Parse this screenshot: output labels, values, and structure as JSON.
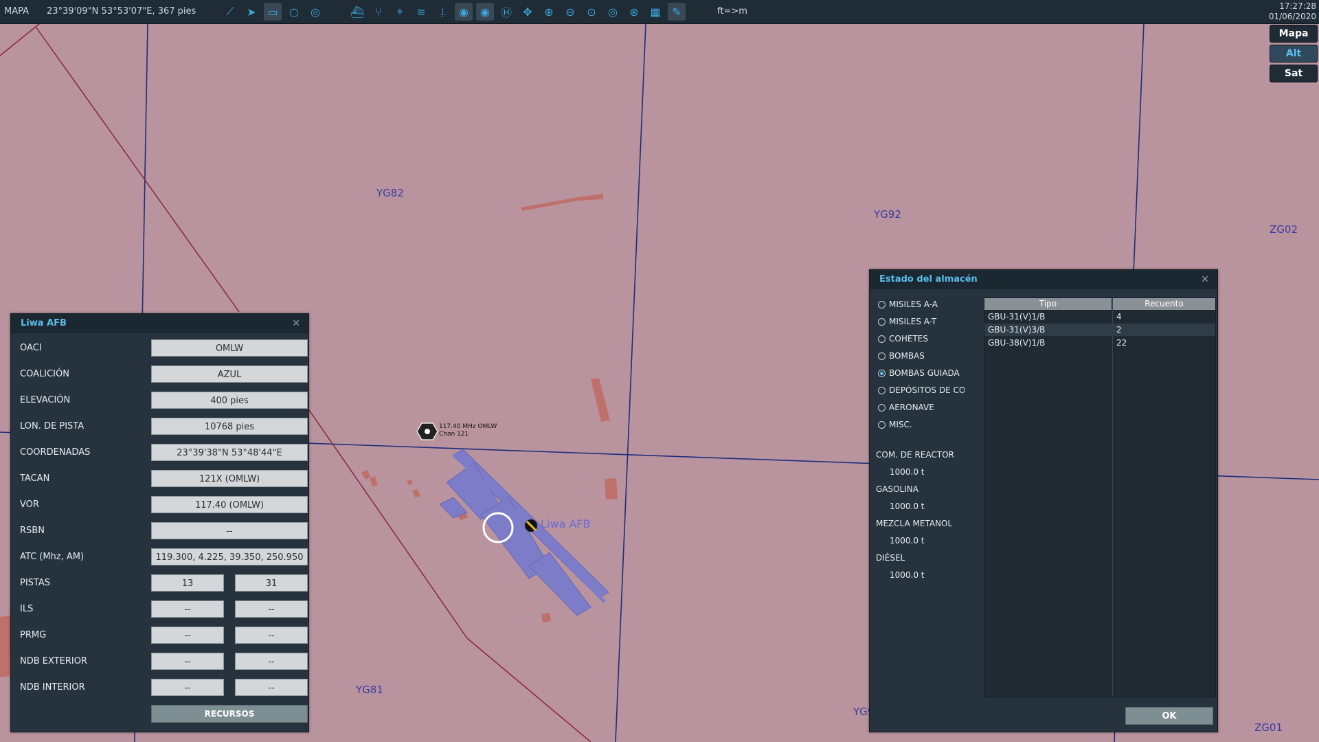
{
  "toolbar": {
    "mode": "MAPA",
    "coords": "23°39'09\"N 53°53'07\"E, 367 pies",
    "units": "ft=>m",
    "time": "17:27:28",
    "date": "01/06/2020",
    "icons": [
      "route-icon",
      "waypoint-icon",
      "ruler-icon",
      "circle-icon",
      "layers-icon",
      "ship-icon",
      "network-icon",
      "crosshair-icon",
      "wifi-icon",
      "tower-icon",
      "radar-airbase-icon",
      "radar-icon",
      "helipad-icon",
      "pan-icon",
      "zoom-in-icon",
      "zoom-out-icon",
      "zoom-fit-icon",
      "target-icon",
      "globe-icon",
      "grid-icon",
      "pencil-icon"
    ]
  },
  "map_type": {
    "buttons": [
      "Mapa",
      "Alt",
      "Sat"
    ],
    "selected": "Alt"
  },
  "map": {
    "grid_labels": [
      "YG82",
      "YG92",
      "ZG02",
      "YG81",
      "YG9",
      "ZG01"
    ],
    "nav_label_line1": "117.40 MHz OMLW",
    "nav_label_line2": "Chan 121",
    "airfield_label": "Liwa AFB"
  },
  "airbase_panel": {
    "title": "Liwa AFB",
    "rows": [
      {
        "label": "OACI",
        "value": "OMLW"
      },
      {
        "label": "COALICIÓN",
        "value": "AZUL"
      },
      {
        "label": "ELEVACIÓN",
        "value": "400 pies"
      },
      {
        "label": "LON. DE PISTA",
        "value": "10768 pies"
      },
      {
        "label": "COORDENADAS",
        "value": "23°39'38\"N 53°48'44\"E"
      },
      {
        "label": "TACAN",
        "value": "121X (OMLW)"
      },
      {
        "label": "VOR",
        "value": "117.40 (OMLW)"
      },
      {
        "label": "RSBN",
        "value": "--"
      },
      {
        "label": "ATC  (Mhz, AM)",
        "value": "119.300, 4.225, 39.350, 250.950"
      }
    ],
    "pair_rows": [
      {
        "label": "PISTAS",
        "a": "13",
        "b": "31"
      },
      {
        "label": "ILS",
        "a": "--",
        "b": "--"
      },
      {
        "label": "PRMG",
        "a": "--",
        "b": "--"
      },
      {
        "label": "NDB EXTERIOR",
        "a": "--",
        "b": "--"
      },
      {
        "label": "NDB INTERIOR",
        "a": "--",
        "b": "--"
      }
    ],
    "button": "RECURSOS"
  },
  "store_panel": {
    "title": "Estado del almacén",
    "categories": [
      "MISILES A-A",
      "MISILES A-T",
      "COHETES",
      "BOMBAS",
      "BOMBAS GUIADA",
      "DEPÓSITOS DE CO",
      "AERONAVE",
      "MISC."
    ],
    "selected_category": "BOMBAS GUIADA",
    "fuels": [
      {
        "label": "COM. DE REACTOR",
        "value": "1000.0 t"
      },
      {
        "label": "GASOLINA",
        "value": "1000.0 t"
      },
      {
        "label": "MEZCLA METANOL",
        "value": "1000.0 t"
      },
      {
        "label": "DIÉSEL",
        "value": "1000.0 t"
      }
    ],
    "table": {
      "headers": [
        "Tipo",
        "Recuento"
      ],
      "rows": [
        [
          "GBU-31(V)1/B",
          "4"
        ],
        [
          "GBU-31(V)3/B",
          "2"
        ],
        [
          "GBU-38(V)1/B",
          "22"
        ]
      ]
    },
    "ok": "OK"
  },
  "colors": {
    "map_bg": "#b9949e",
    "accent": "#59bdea",
    "airfield": "#7c7cc8"
  }
}
